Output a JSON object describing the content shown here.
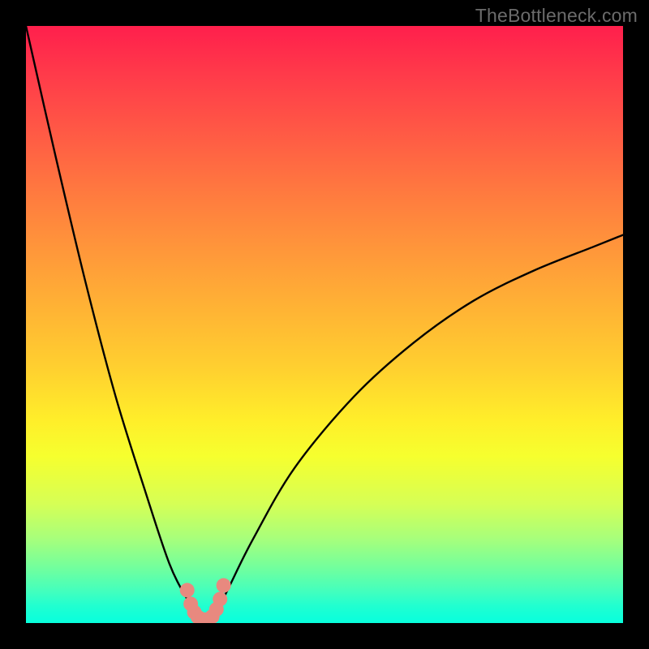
{
  "watermark": {
    "text": "TheBottleneck.com"
  },
  "chart_data": {
    "type": "line",
    "title": "",
    "xlabel": "",
    "ylabel": "",
    "xlim": [
      0,
      100
    ],
    "ylim": [
      0,
      100
    ],
    "series": [
      {
        "name": "bottleneck-curve",
        "x": [
          0,
          5,
          10,
          15,
          20,
          24,
          27,
          29,
          30,
          31,
          32,
          34,
          38,
          45,
          55,
          65,
          75,
          85,
          95,
          100
        ],
        "values": [
          100,
          78,
          57,
          38,
          22,
          10,
          4,
          1,
          0,
          0.5,
          2,
          6,
          14,
          26,
          38,
          47,
          54,
          59,
          63,
          65
        ]
      }
    ],
    "markers": {
      "name": "highlight-beads",
      "color": "#e8897f",
      "points": [
        {
          "x": 27.0,
          "y": 5.5
        },
        {
          "x": 27.6,
          "y": 3.2
        },
        {
          "x": 28.2,
          "y": 1.8
        },
        {
          "x": 28.8,
          "y": 1.0
        },
        {
          "x": 29.6,
          "y": 0.6
        },
        {
          "x": 30.4,
          "y": 0.6
        },
        {
          "x": 31.2,
          "y": 1.1
        },
        {
          "x": 31.9,
          "y": 2.3
        },
        {
          "x": 32.5,
          "y": 4.0
        },
        {
          "x": 33.1,
          "y": 6.3
        }
      ]
    }
  }
}
